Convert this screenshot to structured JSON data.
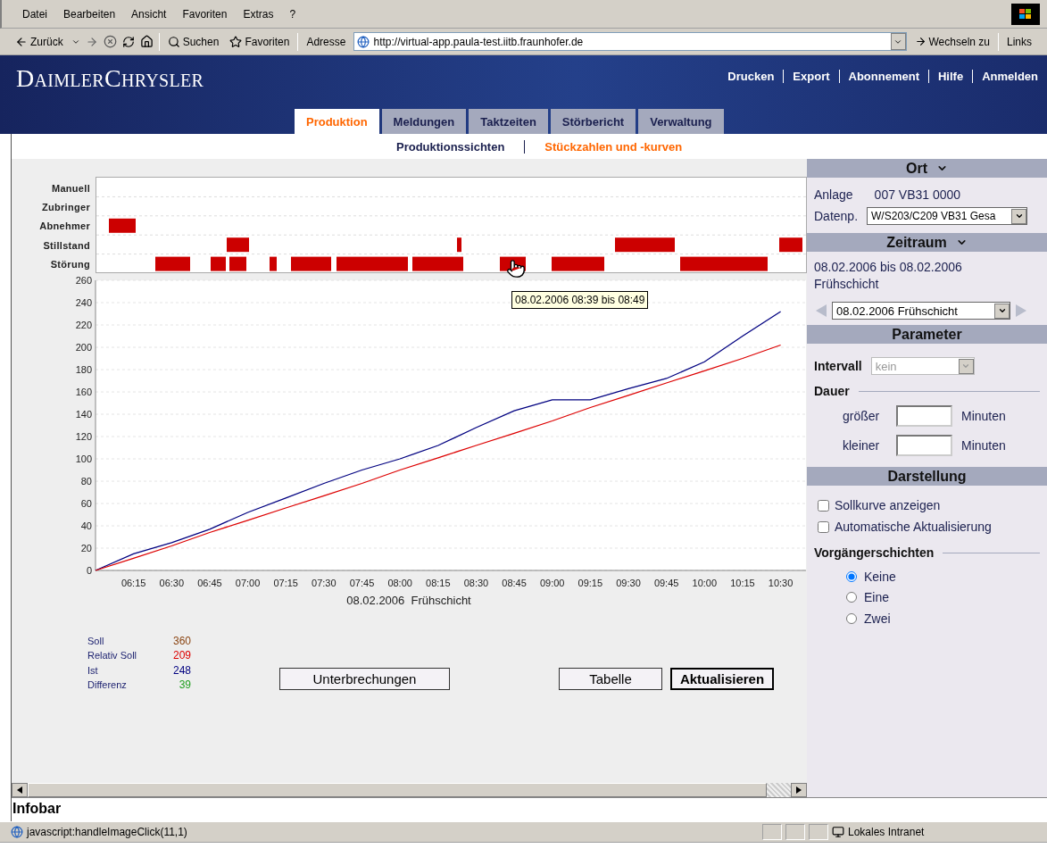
{
  "menu": [
    "Datei",
    "Bearbeiten",
    "Ansicht",
    "Favoriten",
    "Extras",
    "?"
  ],
  "toolbar": {
    "back": "Zurück",
    "search": "Suchen",
    "favorites": "Favoriten",
    "address_label": "Adresse",
    "address": "http://virtual-app.paula-test.iitb.fraunhofer.de",
    "go": "Wechseln zu",
    "links": "Links"
  },
  "header": {
    "logo": "DaimlerChrysler",
    "links": [
      "Drucken",
      "Export",
      "Abonnement",
      "Hilfe",
      "Anmelden"
    ]
  },
  "tabs": [
    {
      "label": "Produktion",
      "selected": true
    },
    {
      "label": "Meldungen",
      "selected": false
    },
    {
      "label": "Taktzeiten",
      "selected": false
    },
    {
      "label": "Störbericht",
      "selected": false
    },
    {
      "label": "Verwaltung",
      "selected": false
    }
  ],
  "subnav": [
    {
      "label": "Produktionssichten",
      "selected": false
    },
    {
      "label": "Stückzahlen und -kurven",
      "selected": true
    }
  ],
  "gantt": {
    "categories": [
      "Manuell",
      "Zubringer",
      "Abnehmer",
      "Stillstand",
      "Störung"
    ]
  },
  "tooltip": "08.02.2006 08:39 bis 08:49",
  "chart": {
    "chart_data": {
      "type": "line",
      "xlabel": "08.02.2006  Frühschicht",
      "categories": [
        null,
        "06:15",
        "06:30",
        "06:45",
        "07:00",
        "07:15",
        "07:30",
        "07:45",
        "08:00",
        "08:15",
        "08:30",
        "08:45",
        "09:00",
        "09:15",
        "09:30",
        "09:45",
        "10:00",
        "10:15",
        "10:30"
      ],
      "series": [
        {
          "color": "#000080",
          "values": [
            0,
            15,
            25,
            37,
            52,
            65,
            78,
            90,
            100,
            112,
            128,
            143,
            153,
            153,
            163,
            172,
            187,
            210,
            232
          ]
        },
        {
          "color": "#dd0000",
          "values": [
            0,
            11,
            22,
            34,
            45,
            56,
            67,
            78,
            90,
            101,
            112,
            123,
            134,
            146,
            157,
            168,
            179,
            190,
            202
          ]
        }
      ],
      "ylim": [
        0,
        260
      ],
      "grid": true,
      "yticks": [
        0,
        20,
        40,
        60,
        80,
        100,
        120,
        140,
        160,
        180,
        200,
        220,
        240,
        260
      ]
    }
  },
  "summary": [
    {
      "label": "Soll",
      "value": "360",
      "color": "#8b4513"
    },
    {
      "label": "Relativ Soll",
      "value": "209",
      "color": "#dd0000"
    },
    {
      "label": "Ist",
      "value": "248",
      "color": "#000080"
    },
    {
      "label": "Differenz",
      "value": "39",
      "color": "#22a022"
    }
  ],
  "buttons": [
    {
      "label": "Unterbrechungen",
      "kind": "normal"
    },
    {
      "label": "Tabelle",
      "kind": "normal"
    },
    {
      "label": "Aktualisieren",
      "kind": "default"
    }
  ],
  "sidebar": {
    "ort": {
      "title": "Ort",
      "anlage_label": "Anlage",
      "anlage": "007 VB31 0000",
      "datenp_label": "Datenp.",
      "datenp": "W/S203/C209 VB31 Gesa"
    },
    "zeitraum": {
      "title": "Zeitraum",
      "range": "08.02.2006 bis 08.02.2006 Frühschicht",
      "select": "08.02.2006 Frühschicht"
    },
    "parameter": {
      "title": "Parameter",
      "intervall_label": "Intervall",
      "intervall": "kein",
      "intervall_disabled": true,
      "dauer": "Dauer",
      "rows": [
        {
          "label": "größer",
          "unit": "Minuten"
        },
        {
          "label": "kleiner",
          "unit": "Minuten"
        }
      ]
    },
    "darstellung": {
      "title": "Darstellung",
      "checks": [
        {
          "label": "Sollkurve anzeigen",
          "checked": false
        },
        {
          "label": "Automatische Aktualisierung",
          "checked": false
        }
      ],
      "vorg": "Vorgängerschichten",
      "radios": [
        {
          "label": "Keine",
          "selected": true
        },
        {
          "label": "Eine",
          "selected": false
        },
        {
          "label": "Zwei",
          "selected": false
        }
      ]
    }
  },
  "infobar": "Infobar",
  "status": {
    "text": "javascript:handleImageClick(11,1)",
    "zone": "Lokales Intranet"
  }
}
